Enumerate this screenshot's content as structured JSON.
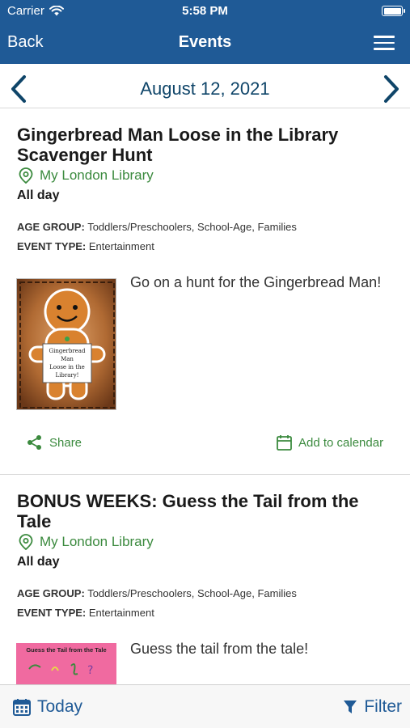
{
  "status_bar": {
    "carrier": "Carrier",
    "time": "5:58 PM"
  },
  "header": {
    "back_label": "Back",
    "title": "Events"
  },
  "date_nav": {
    "date": "August 12, 2021"
  },
  "events": [
    {
      "title": "Gingerbread Man Loose in the Library Scavenger Hunt",
      "location": "My London Library",
      "time": "All day",
      "age_group_label": "AGE GROUP:",
      "age_group_value": "Toddlers/Preschoolers, School-Age, Families",
      "event_type_label": "EVENT TYPE:",
      "event_type_value": "Entertainment",
      "description": "Go on a hunt for the Gingerbread Man!",
      "image_sign_text": "Gingerbread Man Loose in the Library!",
      "share_label": "Share",
      "calendar_label": "Add to calendar"
    },
    {
      "title": "BONUS WEEKS: Guess the Tail from the Tale",
      "location": "My London Library",
      "time": "All day",
      "age_group_label": "AGE GROUP:",
      "age_group_value": "Toddlers/Preschoolers, School-Age, Families",
      "event_type_label": "EVENT TYPE:",
      "event_type_value": "Entertainment",
      "description": "Guess the tail from the tale!",
      "image_caption": "Guess the Tail from the Tale"
    }
  ],
  "toolbar": {
    "today_label": "Today",
    "filter_label": "Filter"
  },
  "colors": {
    "header_bg": "#1f5a96",
    "accent_green": "#3b8a3e",
    "date_text": "#0f4569",
    "toolbar_text": "#1f5a96"
  }
}
